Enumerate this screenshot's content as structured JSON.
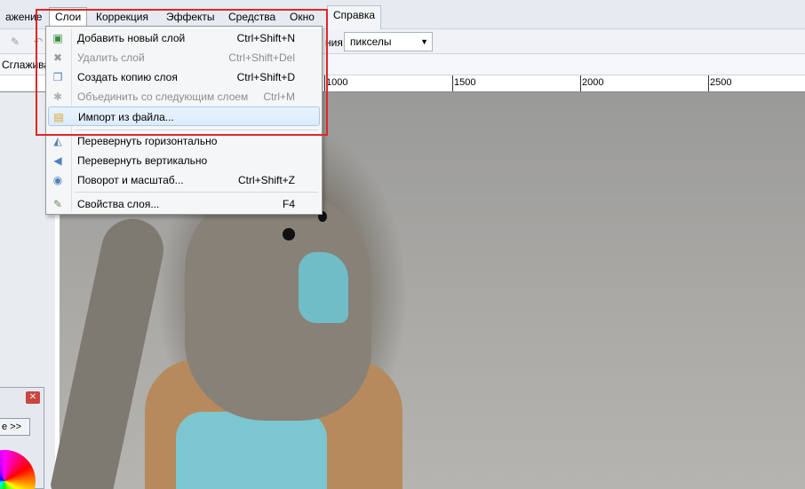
{
  "menubar": {
    "items": [
      "ажение",
      "Слои",
      "Коррекция",
      "Эффекты",
      "Средства",
      "Окно",
      "Справка"
    ]
  },
  "toolbar": {
    "units_label": "ния:",
    "units_value": "пикселы"
  },
  "optbar": {
    "label": "Сглажива"
  },
  "ruler": {
    "labels": [
      "1000",
      "1500",
      "2000",
      "2500"
    ]
  },
  "layers_menu": {
    "items": [
      {
        "label": "Добавить новый слой",
        "shortcut": "Ctrl+Shift+N",
        "icon": "add-layer-icon"
      },
      {
        "label": "Удалить слой",
        "shortcut": "Ctrl+Shift+Del",
        "icon": "delete-layer-icon"
      },
      {
        "label": "Создать копию слоя",
        "shortcut": "Ctrl+Shift+D",
        "icon": "duplicate-layer-icon"
      },
      {
        "label": "Объединить со следующим слоем",
        "shortcut": "Ctrl+M",
        "icon": "merge-layer-icon"
      },
      {
        "label": "Импорт из файла...",
        "shortcut": "",
        "icon": "import-file-icon"
      },
      {
        "label": "Перевернуть горизонтально",
        "shortcut": "",
        "icon": "flip-horizontal-icon"
      },
      {
        "label": "Перевернуть вертикально",
        "shortcut": "",
        "icon": "flip-vertical-icon"
      },
      {
        "label": "Поворот и масштаб...",
        "shortcut": "Ctrl+Shift+Z",
        "icon": "rotate-zoom-icon"
      },
      {
        "label": "Свойства слоя...",
        "shortcut": "F4",
        "icon": "layer-properties-icon"
      }
    ]
  },
  "palette": {
    "more_label": "е >>"
  },
  "colors": {
    "highlight_border": "#a8c9ef",
    "annotation": "#e0262a"
  }
}
